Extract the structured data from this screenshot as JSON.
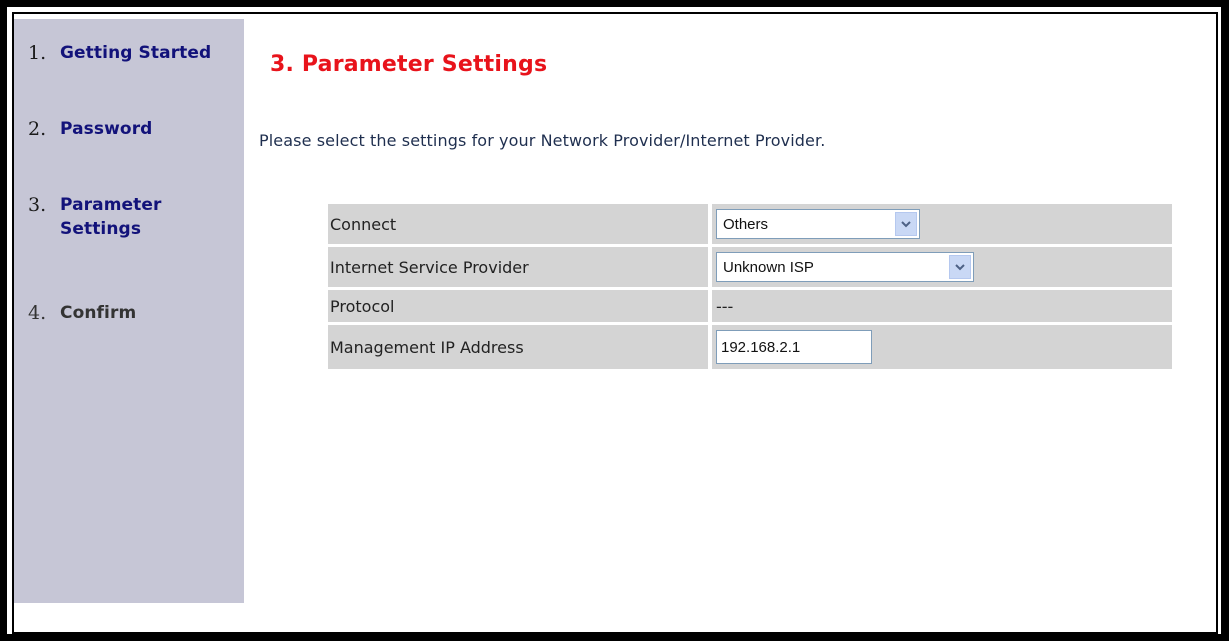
{
  "nav": [
    {
      "num": "1.",
      "label": "Getting Started"
    },
    {
      "num": "2.",
      "label": "Password"
    },
    {
      "num": "3.",
      "label": "Parameter Settings"
    },
    {
      "num": "4.",
      "label": "Confirm"
    }
  ],
  "page": {
    "title": "3. Parameter Settings",
    "intro": "Please select the settings for your Network Provider/Internet Provider."
  },
  "settings": {
    "connect": {
      "label": "Connect",
      "value": "Others"
    },
    "isp": {
      "label": "Internet Service Provider",
      "value": "Unknown ISP"
    },
    "protocol": {
      "label": "Protocol",
      "value": "---"
    },
    "mgmt_ip": {
      "label": "Management IP Address",
      "value": "192.168.2.1"
    }
  },
  "colors": {
    "title": "#e8131b",
    "nav_active": "#12127a",
    "sidebar_bg": "#c6c6d6",
    "row_bg": "#d4d4d4"
  }
}
